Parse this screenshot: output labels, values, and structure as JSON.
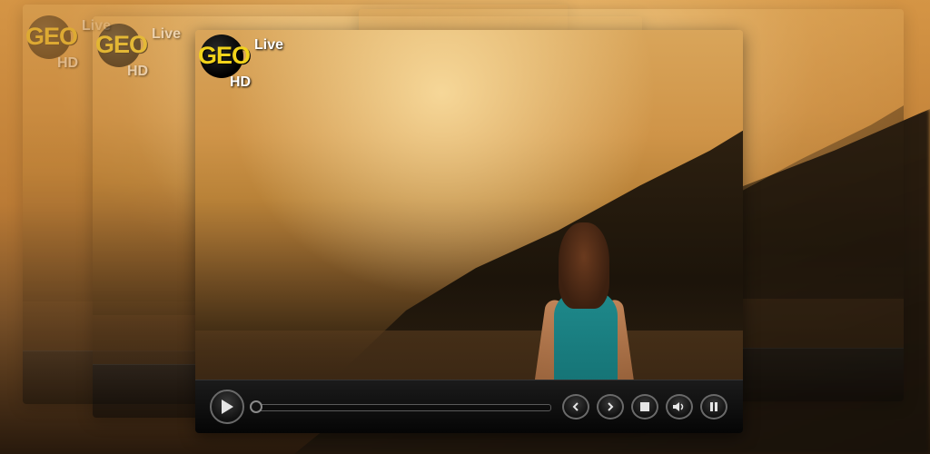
{
  "brand": {
    "logo_text": "GEO",
    "live_label": "Live",
    "hd_label": "HD",
    "logo_color": "#f2d31b"
  },
  "player": {
    "controls": [
      {
        "name": "play",
        "icon": "play-icon"
      },
      {
        "name": "previous",
        "icon": "chevron-left-icon"
      },
      {
        "name": "next",
        "icon": "chevron-right-icon"
      },
      {
        "name": "stop",
        "icon": "stop-icon"
      },
      {
        "name": "volume",
        "icon": "speaker-icon"
      },
      {
        "name": "pause",
        "icon": "pause-icon"
      }
    ],
    "progress": 0.0
  }
}
